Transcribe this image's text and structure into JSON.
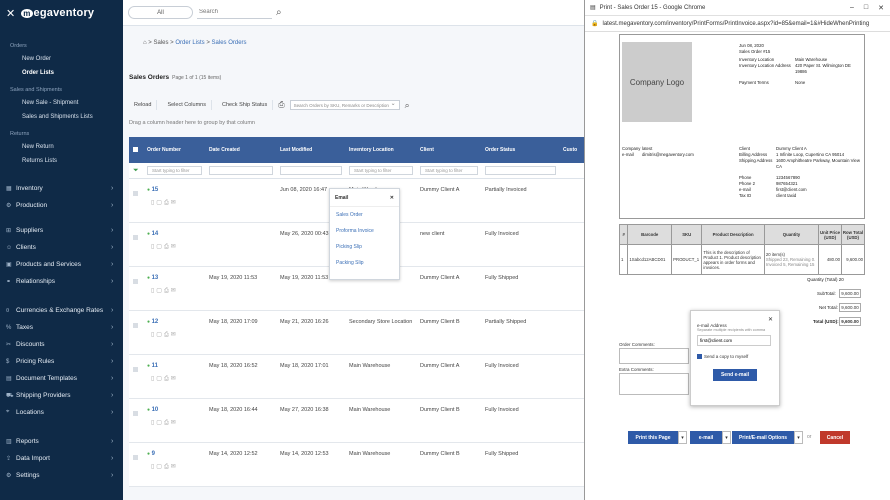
{
  "brand": {
    "name": "egaventory",
    "mark": "m"
  },
  "sidebar": {
    "orders_title": "Orders",
    "orders_items": [
      {
        "label": "New Order"
      },
      {
        "label": "Order Lists"
      }
    ],
    "sales_title": "Sales and Shipments",
    "sales_items": [
      {
        "label": "New Sale - Shipment"
      },
      {
        "label": "Sales and Shipments Lists"
      }
    ],
    "returns_title": "Returns",
    "returns_items": [
      {
        "label": "New Return"
      },
      {
        "label": "Returns Lists"
      }
    ],
    "menu": [
      {
        "label": "Inventory",
        "icon": "inventory-icon"
      },
      {
        "label": "Production",
        "icon": "production-icon"
      },
      {
        "label": "Suppliers",
        "icon": "suppliers-icon"
      },
      {
        "label": "Clients",
        "icon": "clients-icon"
      },
      {
        "label": "Products and Services",
        "icon": "products-icon"
      },
      {
        "label": "Relationships",
        "icon": "relationships-icon"
      },
      {
        "label": "Currencies & Exchange Rates",
        "icon": "currencies-icon"
      },
      {
        "label": "Taxes",
        "icon": "taxes-icon"
      },
      {
        "label": "Discounts",
        "icon": "discounts-icon"
      },
      {
        "label": "Pricing Rules",
        "icon": "pricing-icon"
      },
      {
        "label": "Document Templates",
        "icon": "templates-icon"
      },
      {
        "label": "Shipping Providers",
        "icon": "shipping-icon"
      },
      {
        "label": "Locations",
        "icon": "locations-icon"
      },
      {
        "label": "Reports",
        "icon": "reports-icon"
      },
      {
        "label": "Data Import",
        "icon": "import-icon"
      },
      {
        "label": "Settings",
        "icon": "settings-icon"
      }
    ]
  },
  "topbar": {
    "select_all": "All",
    "search_placeholder": "Search"
  },
  "breadcrumb": {
    "root": "Sales",
    "lists": "Order Lists",
    "current": "Sales Orders"
  },
  "page": {
    "title": "Sales Orders",
    "subtitle": "Page 1 of 1 (15 items)"
  },
  "toolbar": {
    "reload": "Reload",
    "select_columns": "Select Columns",
    "check_ship": "Check Ship Status",
    "grid_search_placeholder": "Search Orders by SKU, Remarks or Description"
  },
  "drag_hint": "Drag a column header here to group by that column",
  "grid": {
    "columns": [
      "Order Number",
      "Date Created",
      "Last Modified",
      "Inventory Location",
      "Client",
      "Order Status",
      "Custo"
    ],
    "filter_placeholder": "Start typing to filter",
    "rows": [
      {
        "num": "15",
        "created": "",
        "modified": "Jun 08, 2020 16:47",
        "loc": "Main Warehouse",
        "client": "Dummy Client A",
        "status": "Partially Invoiced"
      },
      {
        "num": "14",
        "created": "",
        "modified": "May 26, 2020 00:43",
        "loc": "Main Warehouse",
        "client": "new client",
        "status": "Fully Invoiced"
      },
      {
        "num": "13",
        "created": "May 19, 2020 11:53",
        "modified": "May 19, 2020 11:53",
        "loc": "Main Warehouse",
        "client": "Dummy Client A",
        "status": "Fully Shipped"
      },
      {
        "num": "12",
        "created": "May 18, 2020 17:09",
        "modified": "May 21, 2020 16:26",
        "loc": "Secondary Store Location",
        "client": "Dummy Client B",
        "status": "Partially Shipped"
      },
      {
        "num": "11",
        "created": "May 18, 2020 16:52",
        "modified": "May 18, 2020 17:01",
        "loc": "Main Warehouse",
        "client": "Dummy Client A",
        "status": "Fully Invoiced"
      },
      {
        "num": "10",
        "created": "May 18, 2020 16:44",
        "modified": "May 27, 2020 16:38",
        "loc": "Main Warehouse",
        "client": "Dummy Client B",
        "status": "Fully Invoiced"
      },
      {
        "num": "9",
        "created": "May 14, 2020 12:52",
        "modified": "May 14, 2020 12:53",
        "loc": "Main Warehouse",
        "client": "Dummy Client B",
        "status": "Fully Shipped"
      }
    ]
  },
  "email_popup": {
    "title": "Email",
    "items": [
      "Sales Order",
      "Proforma Invoice",
      "Picking Slip",
      "Packing Slip"
    ]
  },
  "chrome": {
    "title": "Print - Sales Order 15 - Google Chrome",
    "url": "latest.megaventory.com/inventory/PrintForms/PrintInvoice.aspx?id=85&email=1&#HideWhenPrinting"
  },
  "invoice": {
    "logo_text": "Company Logo",
    "date": "Jun 08, 2020",
    "order_no": "Sales Order #15",
    "inv_loc_label": "Inventory Location",
    "inv_loc": "Main Warehouse",
    "inv_addr_label": "Inventory Location Address",
    "inv_addr": "420 Paper St. Wilmington DE 19886",
    "pay_label": "Payment Terms",
    "pay": "None",
    "company_label": "Company",
    "company": "latest",
    "email_label": "e-mail",
    "email": "dimitris@megaventory.com",
    "client_label": "Client",
    "client": "Dummy Client A",
    "billing_label": "Billing Address",
    "billing": "1 Infinite Loop, Cupertino CA 95014",
    "ship_label": "Shipping Address",
    "ship": "1600 Amphitheatre Parkway, Mountain View CA",
    "phone_label": "Phone",
    "phone": "1234567890",
    "phone2_label": "Phone 2",
    "phone2": "987654321",
    "cemail_label": "e-mail",
    "cemail": "first@client.com",
    "tax_label": "Tax ID",
    "tax": "client taxid",
    "th": [
      "#",
      "Barcode",
      "SKU",
      "Product Description",
      "Quantity",
      "Unit Price (USD)",
      "Row Total (USD)"
    ],
    "row": [
      "1",
      "1Sabcd12ABCD01",
      "PRODUCT_1",
      "This is the description of Product 1. Product description appears in order forms and invoices.",
      "20 item(s)",
      "480.00",
      "9,600.00"
    ],
    "qty_note": "Shipped 23, Remaining 0. Invoiced 5, Remaining 15",
    "qty_total": "Quantity (Total) 20",
    "subtotal_label": "SubTotal:",
    "subtotal": "9,600.00",
    "net_label": "Net Total:",
    "net": "9,600.00",
    "total_label": "Total (USD):",
    "total": "9,600.00",
    "comments_label": "Order Comments:",
    "extra_label": "Extra Comments:"
  },
  "email_panel": {
    "label": "e-mail Address",
    "hint": "Separate multiple recipients with comma",
    "value": "first@client.com",
    "copy_label": "Send a copy to myself",
    "send": "Send e-mail"
  },
  "print_buttons": {
    "print": "Print this Page",
    "email": "e-mail",
    "print_email": "Print/E-mail Options",
    "or": "or",
    "cancel": "Cancel"
  }
}
